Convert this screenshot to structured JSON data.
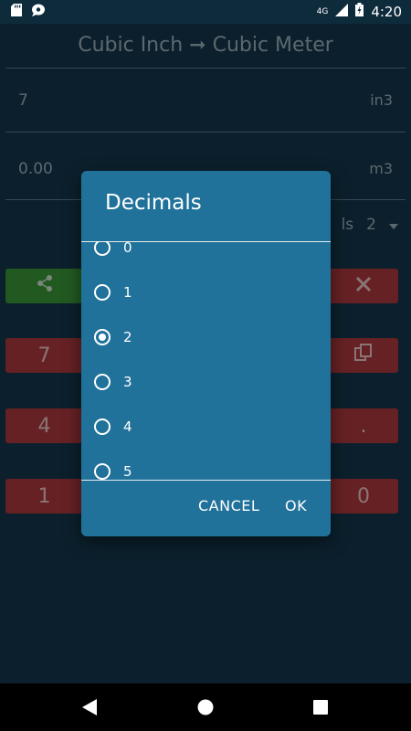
{
  "status": {
    "time": "4:20",
    "network": "4G"
  },
  "appbar": {
    "title": "Cubic Inch ➞ Cubic Meter"
  },
  "input": {
    "value": "7",
    "unit": "in3"
  },
  "output": {
    "value": "0.00",
    "unit": "m3"
  },
  "decimals_row": {
    "label_partial": "ls",
    "value": "2"
  },
  "keypad": {
    "row1": [
      "7",
      ""
    ],
    "row2": [
      "4",
      "."
    ],
    "row3": [
      "1",
      "0"
    ]
  },
  "dialog": {
    "title": "Decimals",
    "options": [
      "0",
      "1",
      "2",
      "3",
      "4",
      "5"
    ],
    "selected": "2",
    "cancel_label": "CANCEL",
    "ok_label": "OK"
  },
  "colors": {
    "background": "#14384d",
    "dialog": "#21729a",
    "button_red": "#b03a3f",
    "button_green": "#3a9a3a"
  }
}
